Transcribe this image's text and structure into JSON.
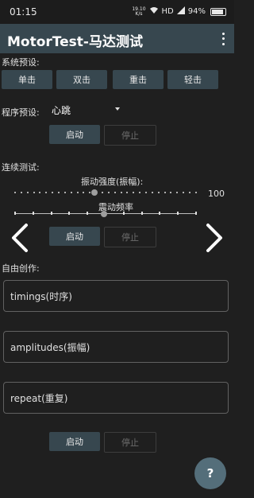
{
  "status_bar": {
    "time": "01:15",
    "net_speed": "19.10",
    "net_unit": "K/s",
    "network": "HD",
    "battery": "94%"
  },
  "app_bar": {
    "title": "MotorTest-马达测试"
  },
  "system_presets": {
    "label": "系统预设:",
    "buttons": [
      "单击",
      "双击",
      "重击",
      "轻击"
    ]
  },
  "program_presets": {
    "label": "程序预设:",
    "selected": "心跳",
    "start": "启动",
    "stop": "停止"
  },
  "continuous_test": {
    "label": "连续测试:",
    "intensity_label": "振动强度(振幅):",
    "intensity_value": "100",
    "intensity_level": 0.44,
    "frequency_label": "震动频率",
    "frequency_level": 0.49,
    "start": "启动",
    "stop": "停止"
  },
  "free_creation": {
    "label": "自由创作:",
    "timings_placeholder": "timings(时序)",
    "amplitudes_placeholder": "amplitudes(振幅)",
    "repeat_placeholder": "repeat(重复)",
    "start": "启动",
    "stop": "停止"
  },
  "fab": {
    "label": "?"
  }
}
